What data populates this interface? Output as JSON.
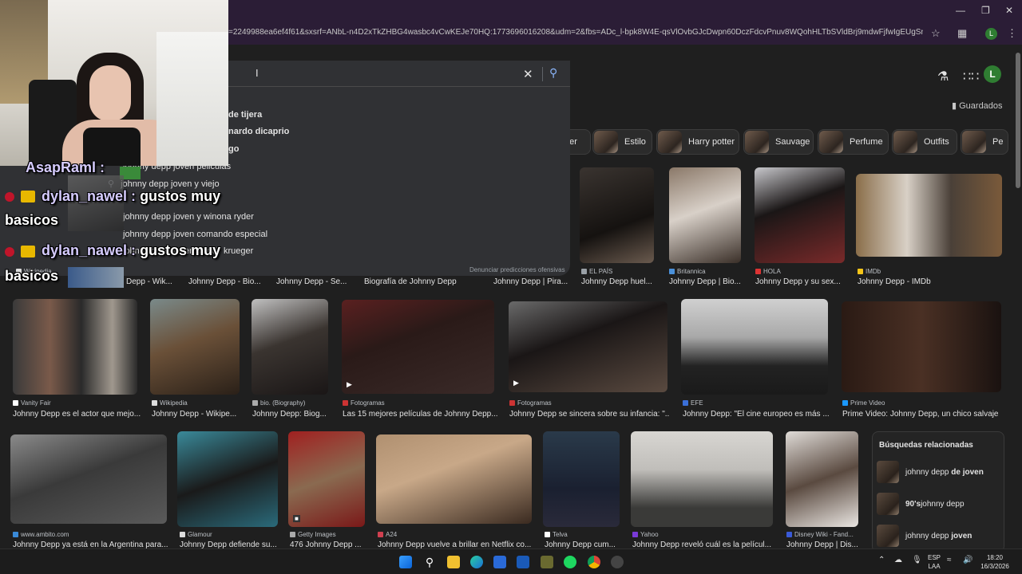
{
  "browser": {
    "url": "=2249988ea6ef4f61&sxsrf=ANbL-n4D2xTkZHBG4wasbc4vCwKEJe70HQ:1773696016208&udm=2&fbs=ADc_l-bpk8W4E-qsVlOvbGJcDwpn60DczFdcvPnuv8WQohHLTbSVldBrj9mdwFjfwIgEUgSngOnSDVho99FxfC...",
    "profile_initial": "L"
  },
  "header": {
    "avatar_initial": "L",
    "guardados": "Guardados"
  },
  "chips": [
    {
      "label": "der"
    },
    {
      "label": "Estilo"
    },
    {
      "label": "Harry potter"
    },
    {
      "label": "Sauvage"
    },
    {
      "label": "Perfume"
    },
    {
      "label": "Outfits"
    },
    {
      "label": "Pe"
    }
  ],
  "suggestions": [
    "de tijera",
    "nardo dicaprio",
    "go",
    "johnny depp joven peliculas",
    "johnny depp joven y viejo",
    "johnny depp joven y winona ryder",
    "johnny depp joven comando especial",
    "johnny depp joven freddy krueger"
  ],
  "denunciar": "Denunciar predicciones ofensivas",
  "row1_captions": [
    "Depp - Wik...",
    "Johnny Depp - Bio...",
    "Johnny Depp - Se...",
    "Biografía de Johnny Depp",
    "Johnny Depp | Pira..."
  ],
  "row1_results": [
    {
      "source": "EL PAÍS",
      "caption": "Johnny Depp huel..."
    },
    {
      "source": "Britannica",
      "caption": "Johnny Depp | Bio..."
    },
    {
      "source": "HOLA",
      "caption": "Johnny Depp y su sex..."
    },
    {
      "source": "IMDb",
      "caption": "Johnny Depp - IMDb"
    }
  ],
  "row2_results": [
    {
      "source": "Vanity Fair",
      "caption": "Johnny Depp es el actor que mejo..."
    },
    {
      "source": "Wikipedia",
      "caption": "Johnny Depp - Wikipe..."
    },
    {
      "source": "bio. (Biography)",
      "caption": "Johnny Depp: Biog..."
    },
    {
      "source": "Fotogramas",
      "caption": "Las 15 mejores películas de Johnny Depp..."
    },
    {
      "source": "Fotogramas",
      "caption": "Johnny Depp se sincera sobre su infancia: \"..."
    },
    {
      "source": "EFE",
      "caption": "Johnny Depp: \"El cine europeo es más ..."
    },
    {
      "source": "Prime Video",
      "caption": "Prime Video: Johnny Depp, un chico salvaje"
    }
  ],
  "row3_results": [
    {
      "source": "www.ambito.com",
      "caption": "Johnny Depp ya está en la Argentina para..."
    },
    {
      "source": "Glamour",
      "caption": "Johnny Depp defiende su..."
    },
    {
      "source": "Getty Images",
      "caption": "476 Johnny Depp ..."
    },
    {
      "source": "A24",
      "caption": "Johnny Depp vuelve a brillar en Netflix co..."
    },
    {
      "source": "Telva",
      "caption": "Johnny Depp cum..."
    },
    {
      "source": "Yahoo",
      "caption": "Johnny Depp reveló cuál es la películ..."
    },
    {
      "source": "Disney Wiki - Fand...",
      "caption": "Johnny Depp | Dis..."
    }
  ],
  "related": {
    "title": "Búsquedas relacionadas",
    "items": [
      {
        "prefix": "johnny depp ",
        "bold": "de joven"
      },
      {
        "prefix": "",
        "bold": "90's",
        "suffix": " johnny depp"
      },
      {
        "prefix": "johnny depp ",
        "bold": "joven"
      }
    ]
  },
  "chat": [
    {
      "user": "AsapRaml :",
      "text": ""
    },
    {
      "user": "dylan_nawel :",
      "text": "gustos muy",
      "cont": "basicos"
    },
    {
      "user": "dylan_nawel :",
      "text": "gustos muy",
      "cont": "basicos"
    }
  ],
  "chat_source_label": "Wikipedia",
  "taskbar": {
    "lang": "ESP",
    "lang2": "LAA",
    "time": "18:20",
    "date": "16/3/2026"
  },
  "colors": {
    "titlebar": "#2b1d36",
    "page_bg": "#1f1f1f",
    "search_panel": "#303134",
    "profile_green": "#2f7d32"
  }
}
